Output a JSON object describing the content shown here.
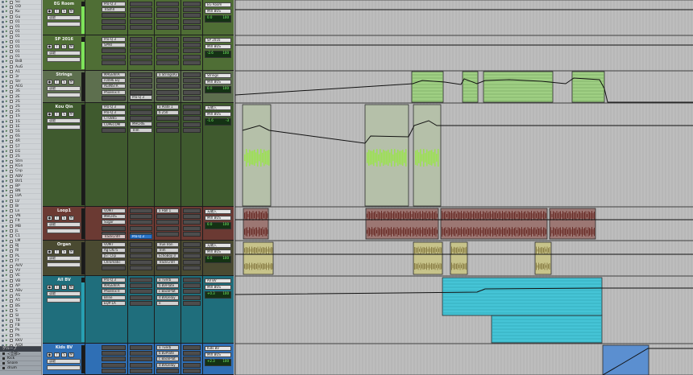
{
  "tracklist": {
    "items": [
      "Su",
      "OD",
      "Ku",
      "Gu",
      "01",
      "01",
      "01",
      "01",
      "01",
      "01",
      "01",
      "01",
      "BsB",
      "AuG",
      "A1",
      "3r",
      "Str",
      "AEG",
      "3S",
      "2E",
      "2S",
      "2S",
      "2S",
      "1S",
      "1S",
      "1E",
      "5S",
      "6S",
      "4R",
      "57",
      "EG",
      "2S",
      "Strn",
      "KGn",
      "Cnp",
      "ABV",
      "BV1",
      "BP",
      "BN",
      "LVA",
      "LV",
      "Br",
      "Ln",
      "VN",
      "Flt",
      "MB",
      "JL",
      "C1",
      "LM",
      "BJ",
      "RI",
      "PL",
      "Ff",
      "AVV",
      "VV",
      "VE",
      "VB",
      "AP",
      "ABv",
      "AS",
      "A5",
      "BS",
      "S",
      "SI",
      "TB",
      "FB",
      "Pn",
      "Ph",
      "KKV",
      "AIDI",
      "HH"
    ],
    "bottom_header": "グループ",
    "bottom_rows": [
      "<全部>",
      "Kick",
      "Snare",
      "drum"
    ]
  },
  "tracks": [
    {
      "name": "EG Room",
      "inserts": [
        "Pro-Q 3",
        "TrashII",
        "",
        "",
        ""
      ],
      "sends": [
        "",
        "",
        "",
        "",
        ""
      ],
      "io_in": "EG Room",
      "io_out": "MIX BUS",
      "vol": "0.0",
      "pan": "100",
      "auto": "读取",
      "group": ""
    },
    {
      "name": "SP 2016",
      "inserts": [
        "Pro-Q 3",
        "SP90",
        "",
        "",
        ""
      ],
      "sends": [
        "",
        "",
        "",
        "",
        ""
      ],
      "io_in": "SP 2016",
      "io_out": "MIX BUS",
      "vol": "-2.6",
      "pan": "100",
      "auto": "读取",
      "group": ""
    },
    {
      "name": "Strings",
      "inserts": [
        "MAGENTA",
        "F0096 EQ",
        "AGINSTR",
        "Phoenix II",
        ""
      ],
      "sends": [
        "a StringsRv",
        "",
        "",
        "",
        ""
      ],
      "extra": "Pro-Q 3",
      "io_in": "Strings",
      "io_out": "MIX BUS",
      "vol": "0.0",
      "pan": "100",
      "auto": "读取",
      "group": ""
    },
    {
      "name": "Kou Qin",
      "inserts": [
        "Pro-Q 3",
        "Pro-Q 3",
        "CTU865",
        "CUPECOM",
        ""
      ],
      "sends": [
        "a Plate 1",
        "b 250",
        "",
        "",
        ""
      ],
      "extra": "MHCRIE",
      "extra2": "Trim",
      "io_in": "无输入",
      "io_out": "MIX BUS",
      "vol": "-1.6",
      "pan": "-3",
      "auto": "读取",
      "group": ""
    },
    {
      "name": "Loop1",
      "inserts": [
        "VUM7",
        "MHCRIS",
        "Sugar",
        "",
        ""
      ],
      "sends": [
        "a Hall 1",
        "",
        "",
        "",
        ""
      ],
      "extra": "TrackCntrl",
      "extra2": "Pro-Q 3",
      "io_in": "无输入",
      "io_out": "MIX BUS",
      "vol": "0.0",
      "pan": "100",
      "auto": "读取",
      "group": ""
    },
    {
      "name": "Organ",
      "inserts": [
        "VUM7",
        "Ag CN75",
        "JST Clip",
        "Chromatic",
        ""
      ],
      "sends": [
        "True Iron",
        "Trim",
        "EchoBoy Jr",
        "TrackCntrl",
        ""
      ],
      "io_in": "无输入",
      "io_out": "MIX BUS",
      "vol": "0.0",
      "pan": "100",
      "auto": "读取",
      "group": ""
    },
    {
      "name": "All BV",
      "inserts": [
        "Pro-Q 3",
        "MAGENTA",
        "Phoenix II",
        "Brine",
        "EQP-1A"
      ],
      "sends": [
        "a Tverb",
        "b BVPlate",
        "c BackPlat",
        "d BVDelay",
        "e"
      ],
      "io_in": "All BV",
      "io_out": "MIX BUS",
      "vol": "+0.3",
      "pan": "100",
      "auto": "读取",
      "group": ""
    },
    {
      "name": "Kids BV",
      "inserts": [
        "",
        "",
        "",
        "",
        ""
      ],
      "sends": [
        "a Tverb",
        "b BvPlate",
        "c BackPlat",
        "d BVDelay",
        ""
      ],
      "io_in": "Kids BV",
      "io_out": "MIX BUS",
      "vol": "+2.3",
      "pan": "100",
      "auto": "读取",
      "group": ""
    }
  ],
  "colors": {
    "green_header": "#4f6e35",
    "strings_header": "#5d6f4e",
    "kouqin_header": "#3f5a2e",
    "loop_header": "#6b3a33",
    "organ_header": "#4a4a31",
    "allbv_header": "#1f6e7c",
    "kidsbv_header": "#2f6fb5",
    "clip_green": "#9fcf83",
    "clip_olive": "#c7c38a",
    "clip_red": "#9c7773",
    "clip_cyan": "#45c4d6",
    "clip_blue": "#5b8fd0"
  }
}
